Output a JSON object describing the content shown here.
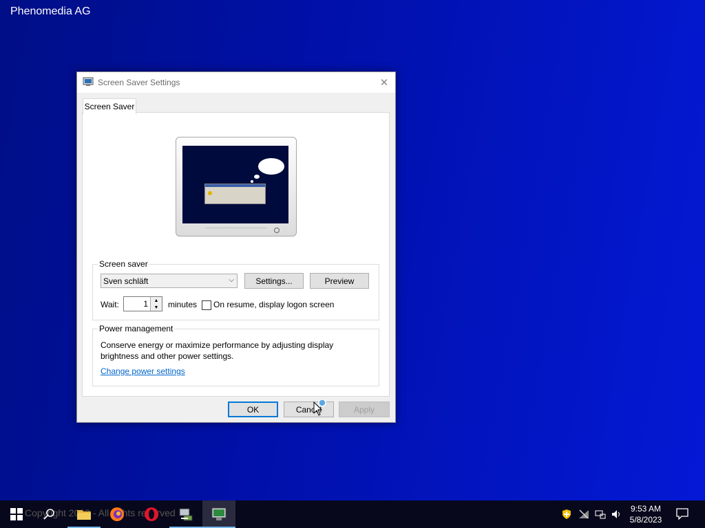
{
  "desktop": {
    "title": "Phenomedia AG"
  },
  "dialog": {
    "title": "Screen Saver Settings",
    "tab": "Screen Saver",
    "screensaver_group": {
      "legend": "Screen saver",
      "selected": "Sven schläft",
      "settings_label": "Settings...",
      "preview_label": "Preview",
      "wait_label": "Wait:",
      "wait_value": "1",
      "minutes_label": "minutes",
      "logon_label": "On resume, display logon screen",
      "logon_checked": false
    },
    "power_group": {
      "legend": "Power management",
      "description": "Conserve energy or maximize performance by adjusting display brightness and other power settings.",
      "link": "Change power settings"
    },
    "buttons": {
      "ok": "OK",
      "cancel": "Cancel",
      "apply": "Apply"
    }
  },
  "taskbar": {
    "copyright": "Copyright 2002 - All rights reserved",
    "items": [
      "start-icon",
      "search-icon",
      "file-explorer-icon",
      "firefox-icon",
      "opera-icon",
      "network-app-icon",
      "screen-saver-settings-icon"
    ],
    "clock": {
      "time": "9:53 AM",
      "date": "5/8/2023"
    }
  },
  "colors": {
    "desktop": "#0010a8",
    "taskbar": "#08081c",
    "link": "#0066cc",
    "accent": "#0078d7"
  }
}
